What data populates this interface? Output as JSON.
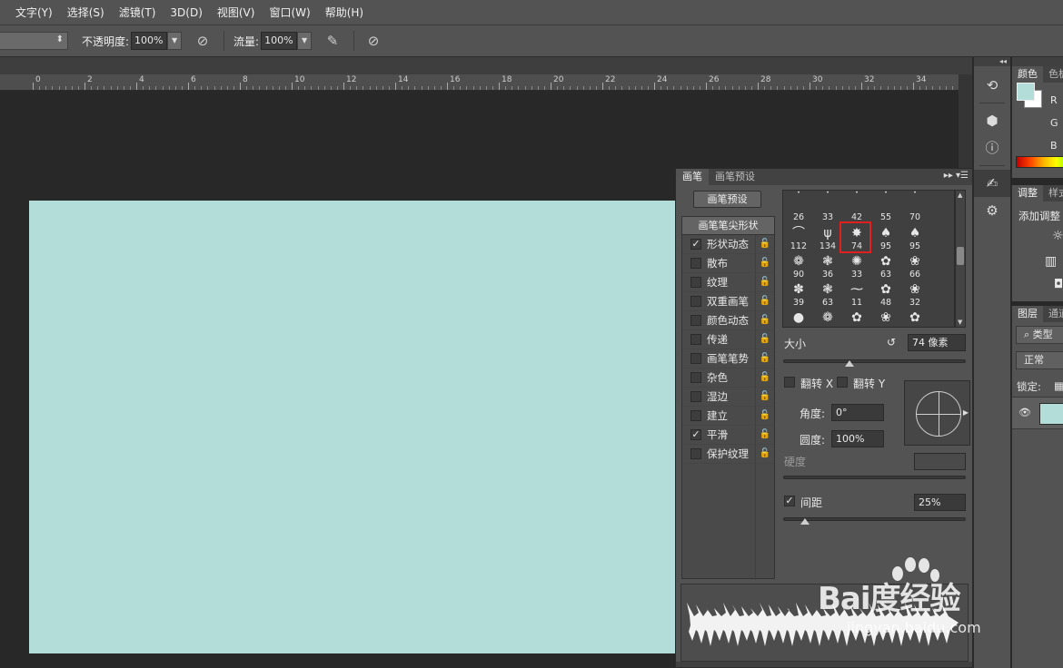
{
  "menu": [
    "文字(Y)",
    "选择(S)",
    "滤镜(T)",
    "3D(D)",
    "视图(V)",
    "窗口(W)",
    "帮助(H)"
  ],
  "options": {
    "opacity_label": "不透明度:",
    "opacity_value": "100%",
    "flow_label": "流量:",
    "flow_value": "100%"
  },
  "ruler": [
    "0",
    "2",
    "4",
    "6",
    "8",
    "10",
    "12",
    "14",
    "16",
    "18",
    "20",
    "22",
    "24",
    "26",
    "28",
    "30",
    "32",
    "34"
  ],
  "canvas": {
    "fill_color": "#b3ddd9"
  },
  "brush_panel": {
    "tab_brush": "画笔",
    "tab_presets": "画笔预设",
    "preset_button": "画笔预设",
    "list_header": "画笔笔尖形状",
    "items": [
      {
        "label": "形状动态",
        "checked": true
      },
      {
        "label": "散布",
        "checked": false
      },
      {
        "label": "纹理",
        "checked": false
      },
      {
        "label": "双重画笔",
        "checked": false
      },
      {
        "label": "颜色动态",
        "checked": false
      },
      {
        "label": "传递",
        "checked": false
      },
      {
        "label": "画笔笔势",
        "checked": false
      },
      {
        "label": "杂色",
        "checked": false
      },
      {
        "label": "湿边",
        "checked": false
      },
      {
        "label": "建立",
        "checked": false
      },
      {
        "label": "平滑",
        "checked": true
      },
      {
        "label": "保护纹理",
        "checked": false
      }
    ],
    "tips": [
      [
        "26",
        "33",
        "42",
        "55",
        "70"
      ],
      [
        "112",
        "134",
        "74",
        "95",
        "95"
      ],
      [
        "90",
        "36",
        "33",
        "63",
        "66"
      ],
      [
        "39",
        "63",
        "11",
        "48",
        "32"
      ]
    ],
    "size_label": "大小",
    "size_value": "74 像素",
    "flip_x_label": "翻转 X",
    "flip_y_label": "翻转 Y",
    "angle_label": "角度:",
    "angle_value": "0°",
    "roundness_label": "圆度:",
    "roundness_value": "100%",
    "hardness_label": "硬度",
    "spacing_label": "间距",
    "spacing_value": "25%",
    "spacing_checked": true
  },
  "right_panels": {
    "color_tab": "颜色",
    "swatches_tab": "色板",
    "r": "R",
    "g": "G",
    "b": "B",
    "adjust_tab": "调整",
    "styles_tab": "样式",
    "add_adjust": "添加调整",
    "layers_tab": "图层",
    "channels_tab": "通道",
    "kind_search": "类型",
    "blend_mode": "正常",
    "lock_label": "锁定:"
  },
  "watermark": {
    "brand": "Bai度经验",
    "url": "jingyan.baidu.com"
  }
}
